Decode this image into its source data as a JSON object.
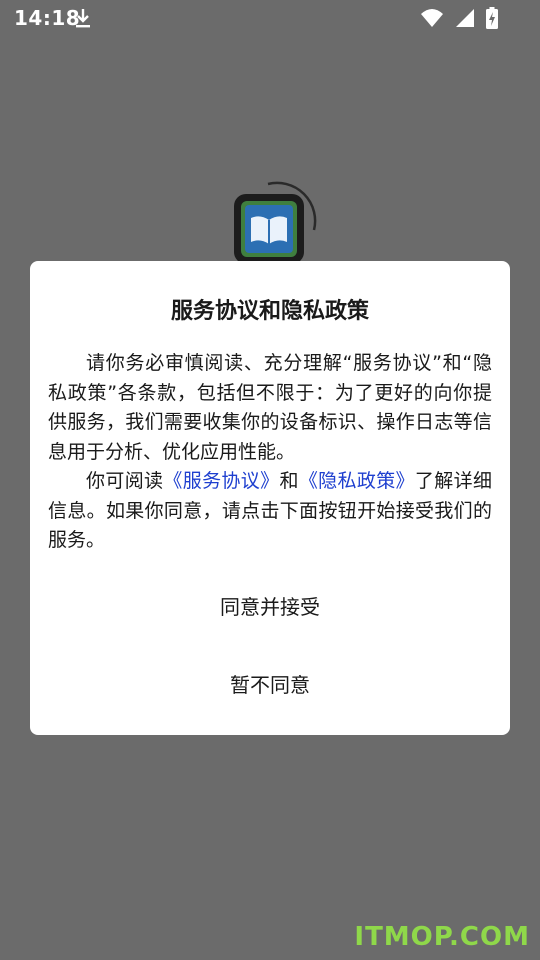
{
  "status_bar": {
    "time": "14:18",
    "download_icon": "download-icon",
    "wifi_icon": "wifi-icon",
    "signal_icon": "signal-icon",
    "battery_icon": "battery-charging-icon"
  },
  "app": {
    "logo_icon": "book-logo-icon"
  },
  "dialog": {
    "title": "服务协议和隐私政策",
    "paragraph1": "请你务必审慎阅读、充分理解“服务协议”和“隐私政策”各条款，包括但不限于：为了更好的向你提供服务，我们需要收集你的设备标识、操作日志等信息用于分析、优化应用性能。",
    "p2_prefix": "你可阅读",
    "service_link": "《服务协议》",
    "p2_and": "和",
    "privacy_link": "《隐私政策》",
    "p2_suffix": "了解详细信息。如果你同意，请点击下面按钮开始接受我们的服务。",
    "accept_label": "同意并接受",
    "decline_label": "暂不同意"
  },
  "watermark": "ITMOP.COM",
  "colors": {
    "overlay": "#6b6b6b",
    "link": "#1e3fcf",
    "watermark": "#8fd84a"
  }
}
